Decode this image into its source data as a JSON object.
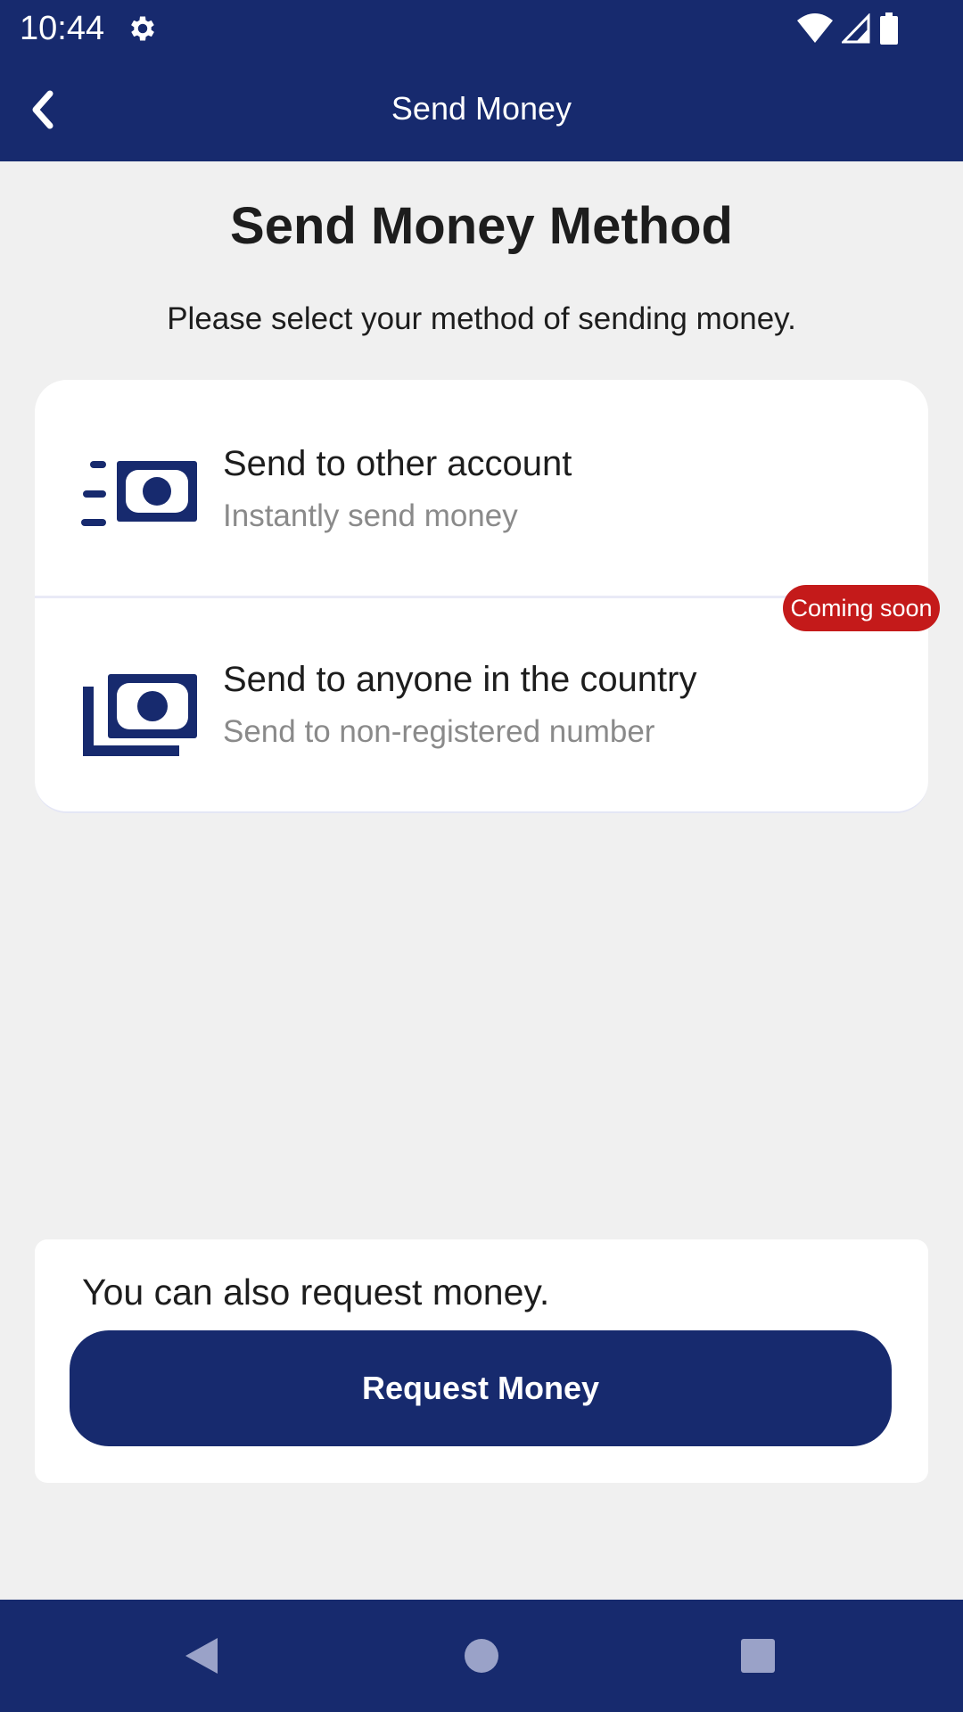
{
  "status_bar": {
    "time": "10:44",
    "icons": [
      "gear-icon",
      "wifi-icon",
      "signal-icon",
      "battery-icon"
    ]
  },
  "top_bar": {
    "title": "Send Money",
    "back_icon": "chevron-left-icon"
  },
  "main": {
    "title": "Send Money Method",
    "subtitle": "Please select your method of sending money.",
    "options": [
      {
        "title": "Send to other account",
        "subtitle": "Instantly send money",
        "icon": "fast-cash-icon"
      },
      {
        "title": "Send to anyone in the country",
        "subtitle": "Send to non-registered number",
        "icon": "stacked-cash-icon",
        "badge": "Coming soon"
      }
    ]
  },
  "request_card": {
    "text": "You can also request money.",
    "button_label": "Request Money"
  },
  "nav_bar": {
    "icons": [
      "back-triangle-icon",
      "home-circle-icon",
      "recents-square-icon"
    ]
  },
  "colors": {
    "primary": "#172a6e",
    "badge": "#c41a1a",
    "background": "#f0f0f0",
    "subtitle_gray": "#8a8a8a"
  }
}
